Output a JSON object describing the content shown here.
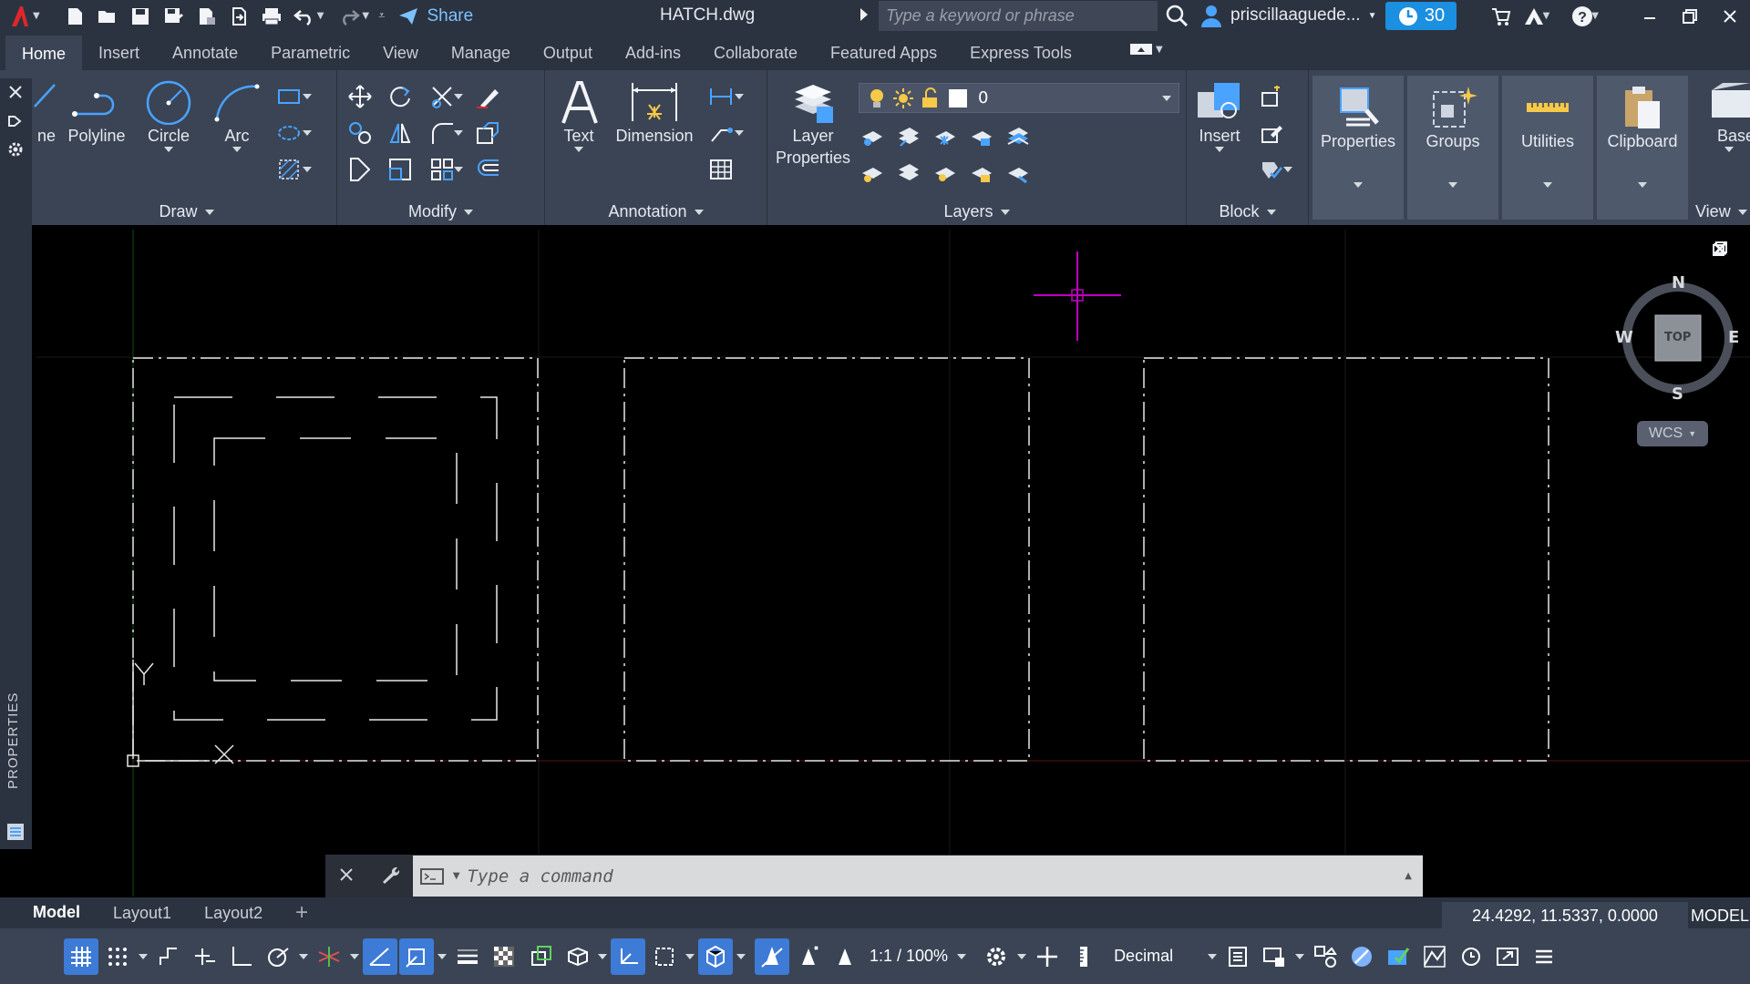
{
  "titlebar": {
    "file_name": "HATCH.dwg",
    "share_label": "Share",
    "search_placeholder": "Type a keyword or phrase",
    "user_name": "priscillaaguede...",
    "trial_days": "30"
  },
  "tabs": [
    "Home",
    "Insert",
    "Annotate",
    "Parametric",
    "View",
    "Manage",
    "Output",
    "Add-ins",
    "Collaborate",
    "Featured Apps",
    "Express Tools"
  ],
  "ribbon": {
    "draw": {
      "title": "Draw",
      "line_partial": "ne",
      "polyline": "Polyline",
      "circle": "Circle",
      "arc": "Arc"
    },
    "modify": {
      "title": "Modify"
    },
    "annotation": {
      "title": "Annotation",
      "text": "Text",
      "dimension": "Dimension"
    },
    "layers": {
      "title": "Layers",
      "layer_properties_1": "Layer",
      "layer_properties_2": "Properties",
      "current_layer": "0"
    },
    "block": {
      "title": "Block",
      "insert": "Insert"
    },
    "properties": "Properties",
    "groups": "Groups",
    "utilities": "Utilities",
    "clipboard": "Clipboard",
    "base_partial": "Base",
    "view_partial": "View"
  },
  "leftbar": {
    "label": "PROPERTIES"
  },
  "viewcube": {
    "n": "N",
    "s": "S",
    "e": "E",
    "w": "W",
    "top": "TOP",
    "wcs": "WCS"
  },
  "command": {
    "placeholder": "Type a command"
  },
  "layout_tabs": [
    "Model",
    "Layout1",
    "Layout2"
  ],
  "status": {
    "coords": "24.4292, 11.5337, 0.0000",
    "mode": "MODEL",
    "scale": "1:1 / 100%",
    "units": "Decimal"
  },
  "colors": {
    "titlebar": "#2b3340",
    "ribbon": "#3a4455",
    "accent": "#1b8fe0",
    "drawing_lines": "#ffffff",
    "cursor": "#c000c0"
  }
}
